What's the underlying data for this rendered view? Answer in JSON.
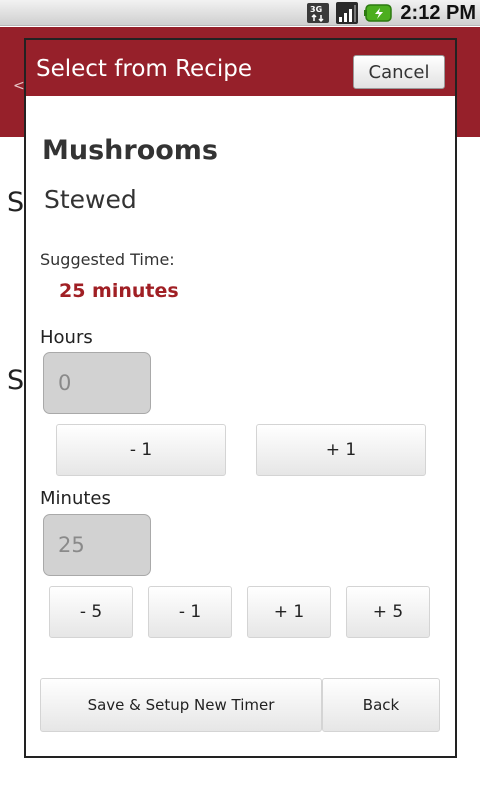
{
  "status_bar": {
    "time": "2:12 PM",
    "icons": [
      "3g-data-icon",
      "signal-strength-icon",
      "battery-charging-icon"
    ]
  },
  "background": {
    "header_color": "#96202a",
    "back_glyph": "<",
    "text_fragments": [
      "S",
      "S"
    ]
  },
  "dialog": {
    "title": "Select from Recipe",
    "cancel_label": "Cancel",
    "recipe_name": "Mushrooms",
    "cooking_method": "Stewed",
    "suggested_label": "Suggested Time:",
    "suggested_value": "25 minutes",
    "hours": {
      "label": "Hours",
      "value": "0",
      "buttons": [
        "- 1",
        "+ 1"
      ]
    },
    "minutes": {
      "label": "Minutes",
      "value": "25",
      "buttons": [
        "- 5",
        "- 1",
        "+ 1",
        "+ 5"
      ]
    },
    "save_label": "Save & Setup New Timer",
    "back_label": "Back"
  },
  "colors": {
    "accent": "#96202a",
    "suggested_time": "#a01f24"
  }
}
